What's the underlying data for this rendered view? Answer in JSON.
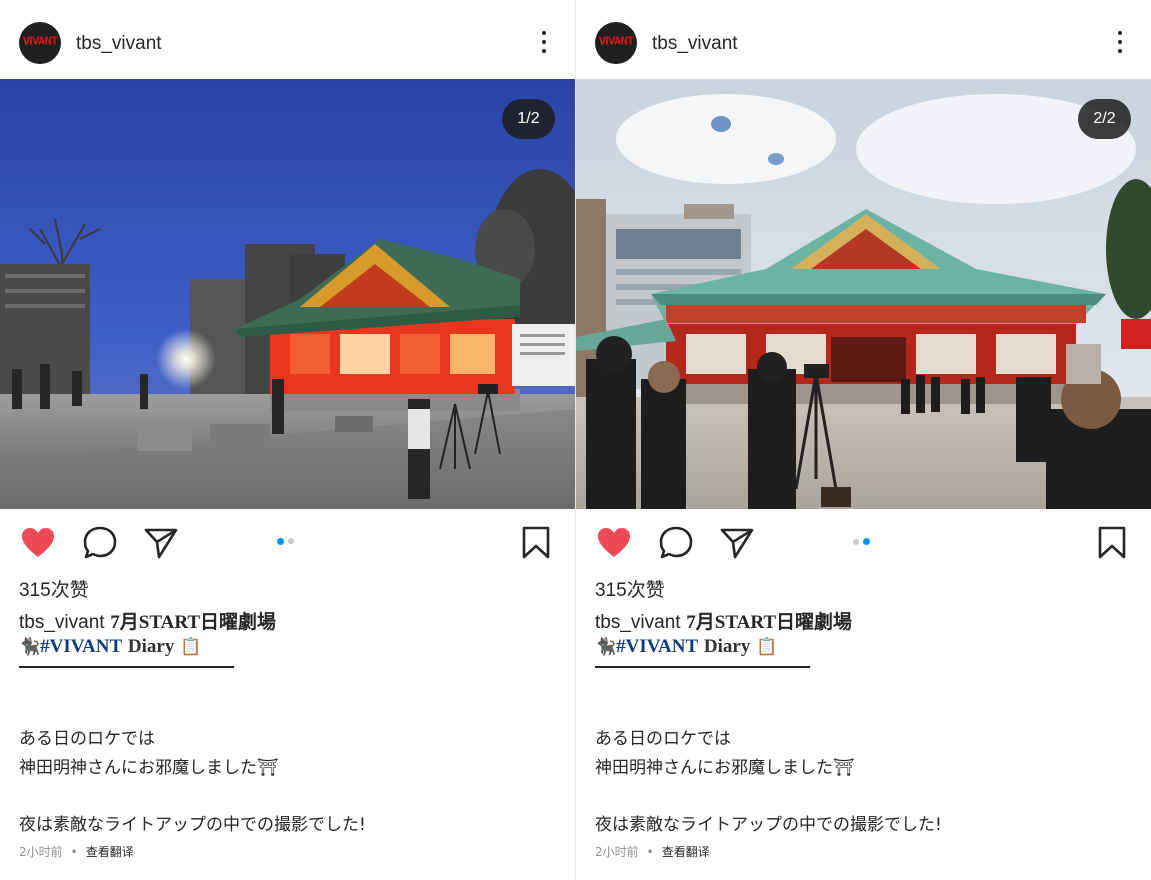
{
  "posts": [
    {
      "username": "tbs_vivant",
      "avatar_text": "VIVANT",
      "counter": "1/2",
      "active_dot": 0,
      "likes": "315次赞",
      "caption": {
        "username": "tbs_vivant",
        "headline": "7月START日曜劇場",
        "tag_emoji": "🐈‍⬛",
        "hashtag": "#VIVANT",
        "diary": "Diary",
        "clip_emoji": "📋",
        "lines": [
          "ある日のロケでは",
          "神田明神さんにお邪魔しました⛩",
          "夜は素敵なライトアップの中での撮影でした!"
        ]
      },
      "time": "2小时前",
      "separator": "•",
      "translate": "查看翻译",
      "icons": [
        "heart-icon",
        "comment-icon",
        "share-icon",
        "bookmark-icon",
        "more-icon"
      ]
    },
    {
      "username": "tbs_vivant",
      "avatar_text": "VIVANT",
      "counter": "2/2",
      "active_dot": 1,
      "likes": "315次赞",
      "caption": {
        "username": "tbs_vivant",
        "headline": "7月START日曜劇場",
        "tag_emoji": "🐈‍⬛",
        "hashtag": "#VIVANT",
        "diary": "Diary",
        "clip_emoji": "📋",
        "lines": [
          "ある日のロケでは",
          "神田明神さんにお邪魔しました⛩",
          "夜は素敵なライトアップの中での撮影でした!"
        ]
      },
      "time": "2小时前",
      "separator": "•",
      "translate": "查看翻译",
      "icons": [
        "heart-icon",
        "comment-icon",
        "share-icon",
        "bookmark-icon",
        "more-icon"
      ]
    }
  ],
  "colors": {
    "like": "#ed4956",
    "dot_active": "#0095f6",
    "dot_inactive": "#c7c7c7",
    "hashtag": "#0f3d7a",
    "muted": "#8e8e8e"
  }
}
